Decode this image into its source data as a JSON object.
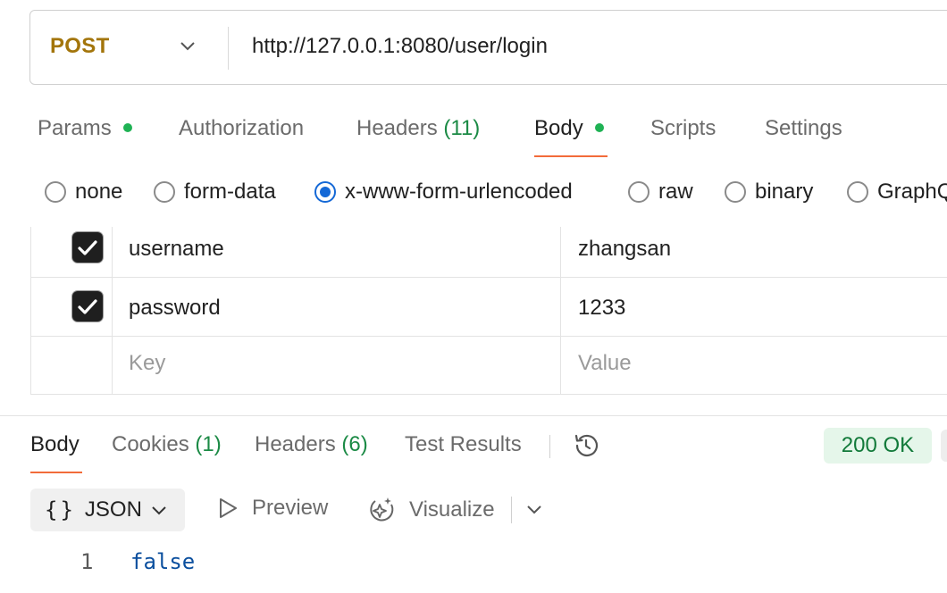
{
  "request": {
    "method": "POST",
    "url": "http://127.0.0.1:8080/user/login"
  },
  "request_tabs": [
    {
      "label": "Params",
      "dot": true
    },
    {
      "label": "Authorization"
    },
    {
      "label": "Headers",
      "count": "(11)"
    },
    {
      "label": "Body",
      "dot": true,
      "active": true
    },
    {
      "label": "Scripts"
    },
    {
      "label": "Settings"
    }
  ],
  "body_types": {
    "options": [
      "none",
      "form-data",
      "x-www-form-urlencoded",
      "raw",
      "binary",
      "GraphQ"
    ],
    "selected": "x-www-form-urlencoded"
  },
  "params_table": {
    "rows": [
      {
        "checked": true,
        "key": "username",
        "value": "zhangsan"
      },
      {
        "checked": true,
        "key": "password",
        "value": "1233"
      }
    ],
    "placeholder": {
      "key": "Key",
      "value": "Value"
    }
  },
  "response": {
    "tabs": [
      {
        "label": "Body",
        "active": true
      },
      {
        "label": "Cookies",
        "count": "(1)"
      },
      {
        "label": "Headers",
        "count": "(6)"
      },
      {
        "label": "Test Results"
      }
    ],
    "status": "200 OK",
    "format": "JSON",
    "preview_label": "Preview",
    "visualize_label": "Visualize",
    "body_lines": [
      {
        "line": "1",
        "text": "false"
      }
    ]
  },
  "colors": {
    "method": "#a3750b",
    "accent_underline": "#f26b3a",
    "dot_green": "#1fb254",
    "count_green": "#1b8a45",
    "radio_selected": "#1468d6",
    "status_bg": "#e5f6ea",
    "status_text": "#127a3a",
    "json_literal": "#0b4f9e"
  }
}
